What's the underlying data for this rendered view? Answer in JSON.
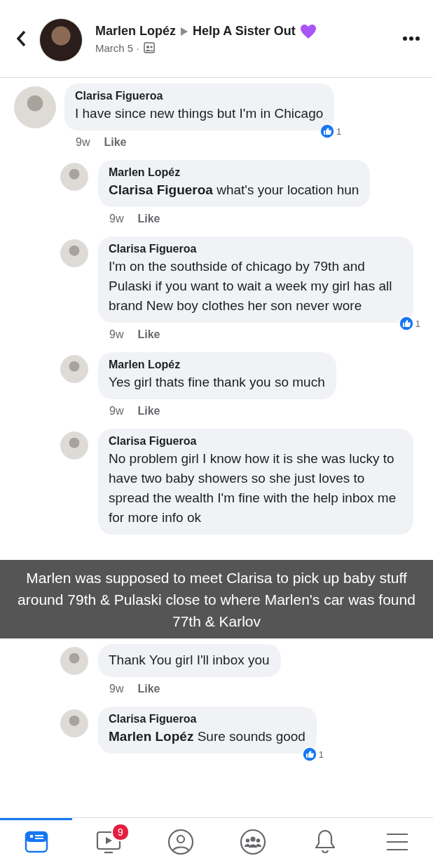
{
  "header": {
    "author": "Marlen Lopéz",
    "group": "Help A Sister Out",
    "date": "March 5 ·"
  },
  "comments": [
    {
      "kind": "top",
      "author": "Clarisa Figueroa",
      "text": "I have since new things but I'm in Chicago",
      "time": "9w",
      "action": "Like",
      "likes": "1"
    },
    {
      "kind": "reply",
      "author": "Marlen Lopéz",
      "text": "**Clarisa Figueroa** what's your location hun",
      "time": "9w",
      "action": "Like"
    },
    {
      "kind": "reply",
      "author": "Clarisa Figueroa",
      "text": "I'm on the southside of chicago by 79th and Pulaski if you want to wait a week my girl has all brand New boy clothes her son never wore",
      "time": "9w",
      "action": "Like",
      "likes": "1"
    },
    {
      "kind": "reply",
      "author": "Marlen Lopéz",
      "text": "Yes girl thats fine thank you so much",
      "time": "9w",
      "action": "Like"
    },
    {
      "kind": "reply",
      "author": "Clarisa Figueroa",
      "text": "No problem girl I know how it is she was lucky to have two baby showers so she just loves to spread the wealth I'm fine with the help inbox me for more info ok"
    },
    {
      "kind": "caption",
      "text": "Marlen was supposed to meet Clarisa to pick up baby stuff around 79th & Pulaski close to where Marlen's car was found 77th & Karlov"
    },
    {
      "kind": "reply",
      "text": "Thank You girl I'll inbox you",
      "time": "9w",
      "action": "Like"
    },
    {
      "kind": "reply",
      "author": "Clarisa Figueroa",
      "text": "**Marlen Lopéz** Sure sounds good",
      "likes": "1"
    }
  ],
  "nav": [
    {
      "kind": "feed",
      "selected": true
    },
    {
      "kind": "video",
      "selected": false,
      "badge": "9"
    },
    {
      "kind": "profile",
      "selected": false
    },
    {
      "kind": "groups",
      "selected": false
    },
    {
      "kind": "bell",
      "selected": false
    },
    {
      "kind": "menu",
      "selected": false
    }
  ]
}
